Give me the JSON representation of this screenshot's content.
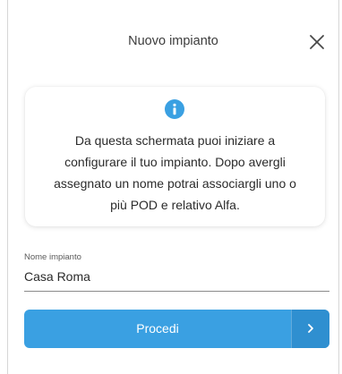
{
  "header": {
    "title": "Nuovo impianto",
    "close_icon": "close-icon"
  },
  "info": {
    "icon": "info-icon",
    "line1": "Da questa schermata puoi iniziare a",
    "line2": "configurare il tuo impianto. Dopo avergli",
    "line3": "assegnato un nome potrai associargli uno o",
    "line4": "più POD e relativo Alfa."
  },
  "form": {
    "name_label": "Nome impianto",
    "name_value": "Casa Roma"
  },
  "actions": {
    "proceed_label": "Procedi",
    "proceed_icon": "chevron-right-icon"
  },
  "colors": {
    "accent": "#3aa0e2",
    "accent_dark": "#2f8fd0",
    "text": "#2b2b2b"
  }
}
